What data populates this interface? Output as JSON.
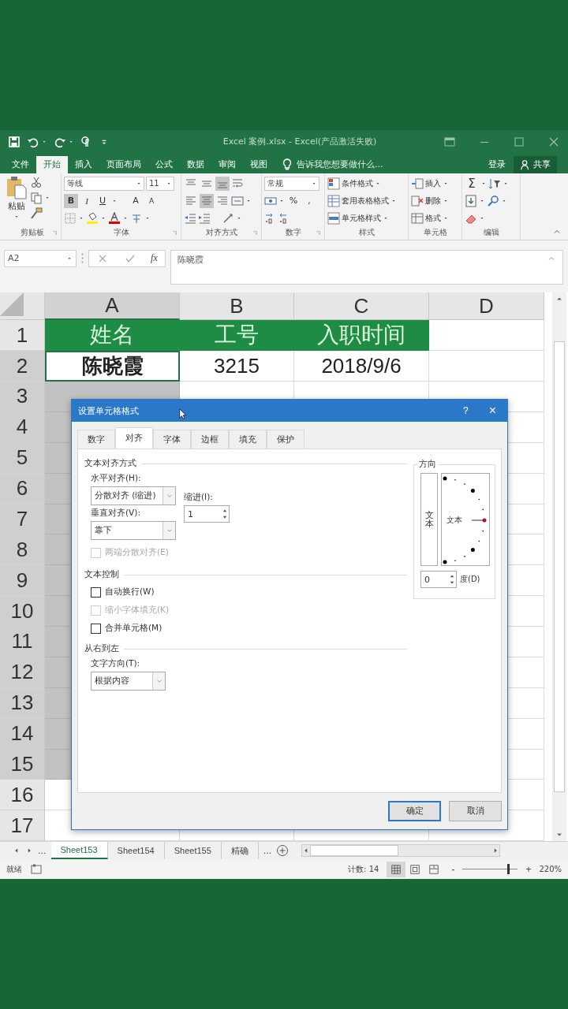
{
  "window": {
    "title": "Excel 案例.xlsx - Excel(产品激活失败)"
  },
  "menu_tabs": [
    {
      "label": "文件",
      "selected": false
    },
    {
      "label": "开始",
      "selected": true
    },
    {
      "label": "插入",
      "selected": false
    },
    {
      "label": "页面布局",
      "selected": false
    },
    {
      "label": "公式",
      "selected": false
    },
    {
      "label": "数据",
      "selected": false
    },
    {
      "label": "审阅",
      "selected": false
    },
    {
      "label": "视图",
      "selected": false
    }
  ],
  "tell_me": {
    "placeholder": "告诉我您想要做什么..."
  },
  "sign_in": "登录",
  "share": "共享",
  "ribbon": {
    "clipboard": {
      "paste": "粘贴",
      "label": "剪贴板"
    },
    "font": {
      "name": "等线",
      "size": "11",
      "bold": {
        "label": "B",
        "selected": true
      },
      "italic": {
        "label": "I",
        "selected": false
      },
      "underline": {
        "label": "U",
        "selected": false
      },
      "grow": "A",
      "shrink": "A",
      "label": "字体"
    },
    "alignment": {
      "vertical_align": [
        {
          "selected": false
        },
        {
          "selected": false
        },
        {
          "selected": true
        }
      ],
      "horizontal_align": [
        {
          "selected": false
        },
        {
          "selected": true
        },
        {
          "selected": false
        }
      ],
      "label": "对齐方式"
    },
    "number": {
      "format": "常规",
      "percent": "%",
      "comma": ",",
      "label": "数字"
    },
    "styles": {
      "items": [
        "条件格式",
        "套用表格格式",
        "单元格样式"
      ],
      "label": "样式"
    },
    "cells": {
      "items": [
        "插入",
        "删除",
        "格式"
      ],
      "label": "单元格"
    },
    "editing": {
      "sum": "Σ",
      "label": "编辑"
    }
  },
  "formula_bar": {
    "name_box": "A2",
    "fx": "fx",
    "value": "陈晓霞"
  },
  "sheet": {
    "columns": [
      {
        "label": "A",
        "selected": true
      },
      {
        "label": "B",
        "selected": false
      },
      {
        "label": "C",
        "selected": false
      },
      {
        "label": "D",
        "selected": false
      }
    ],
    "rows": [
      {
        "number": "1",
        "selected": false,
        "cells": [
          {
            "text": "姓名",
            "kind": "header"
          },
          {
            "text": "工号",
            "kind": "header"
          },
          {
            "text": "入职时间",
            "kind": "header"
          }
        ]
      },
      {
        "number": "2",
        "selected": true,
        "cells": [
          {
            "text": "陈晓霞",
            "kind": "bold",
            "active": true
          },
          {
            "text": "3215",
            "kind": "plain"
          },
          {
            "text": "2018/9/6",
            "kind": "plain"
          }
        ]
      },
      {
        "number": "3",
        "selected": true
      },
      {
        "number": "4",
        "selected": true
      },
      {
        "number": "5",
        "selected": true
      },
      {
        "number": "6",
        "selected": true
      },
      {
        "number": "7",
        "selected": true
      },
      {
        "number": "8",
        "selected": true
      },
      {
        "number": "9",
        "selected": true
      },
      {
        "number": "10",
        "selected": true
      },
      {
        "number": "11",
        "selected": true
      },
      {
        "number": "12",
        "selected": true
      },
      {
        "number": "13",
        "selected": true
      },
      {
        "number": "14",
        "selected": true
      },
      {
        "number": "15",
        "selected": true
      },
      {
        "number": "16",
        "selected": false
      },
      {
        "number": "17",
        "selected": false
      }
    ]
  },
  "dialog": {
    "title": "设置单元格格式",
    "help": "?",
    "close": "×",
    "tabs": [
      {
        "label": "数字",
        "selected": false
      },
      {
        "label": "对齐",
        "selected": true
      },
      {
        "label": "字体",
        "selected": false
      },
      {
        "label": "边框",
        "selected": false
      },
      {
        "label": "填充",
        "selected": false
      },
      {
        "label": "保护",
        "selected": false
      }
    ],
    "text_alignment": {
      "title": "文本对齐方式",
      "horizontal": {
        "label": "水平对齐(H):",
        "value": "分散对齐 (缩进)"
      },
      "indent": {
        "label": "缩进(I):",
        "value": "1"
      },
      "vertical": {
        "label": "垂直对齐(V):",
        "value": "靠下"
      },
      "justify_distributed": {
        "label": "两端分散对齐(E)",
        "checked": false,
        "disabled": true
      }
    },
    "text_control": {
      "title": "文本控制",
      "options": [
        {
          "label": "自动换行(W)",
          "checked": false,
          "disabled": false
        },
        {
          "label": "缩小字体填充(K)",
          "checked": false,
          "disabled": true
        },
        {
          "label": "合并单元格(M)",
          "checked": false,
          "disabled": false
        }
      ]
    },
    "right_to_left": {
      "title": "从右到左",
      "direction": {
        "label": "文字方向(T):",
        "value": "根据内容"
      }
    },
    "orientation": {
      "title": "方向",
      "vertical_text": "文本",
      "dial_text": "文本",
      "degrees": {
        "value": "0",
        "label": "度(D)"
      }
    },
    "buttons": [
      {
        "label": "确定",
        "kind": "default"
      },
      {
        "label": "取消",
        "kind": "normal"
      }
    ]
  },
  "sheet_tabs": {
    "more_left": "...",
    "tabs": [
      {
        "label": "Sheet153",
        "selected": true
      },
      {
        "label": "Sheet154",
        "selected": false
      },
      {
        "label": "Sheet155",
        "selected": false
      },
      {
        "label": "精确",
        "selected": false
      }
    ],
    "more_right": "..."
  },
  "status_bar": {
    "ready": "就绪",
    "count": "计数: 14",
    "views": [
      {
        "selected": true
      },
      {
        "selected": false
      },
      {
        "selected": false
      }
    ],
    "zoom_out": "-",
    "zoom_in": "+",
    "zoom": {
      "level": 0.82
    },
    "zoom_text": "220%"
  }
}
